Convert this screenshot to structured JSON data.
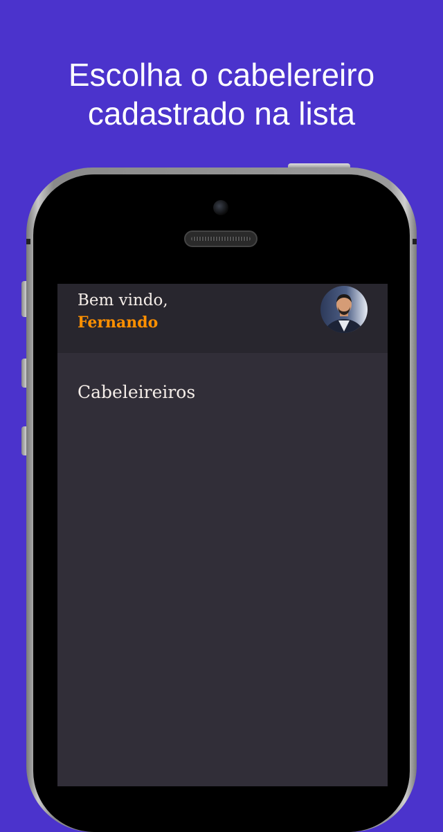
{
  "promo": {
    "headline_line1": "Escolha o cabelereiro",
    "headline_line2": "cadastrado na lista"
  },
  "header": {
    "greeting": "Bem vindo,",
    "username": "Fernando",
    "avatar_icon": "user-avatar"
  },
  "main": {
    "section_title": "Cabeleireiros"
  },
  "colors": {
    "background": "#4b33cc",
    "accent": "#ff9000",
    "screen_bg": "#312e38",
    "header_bg": "#28262e",
    "text": "#f4ede8"
  }
}
